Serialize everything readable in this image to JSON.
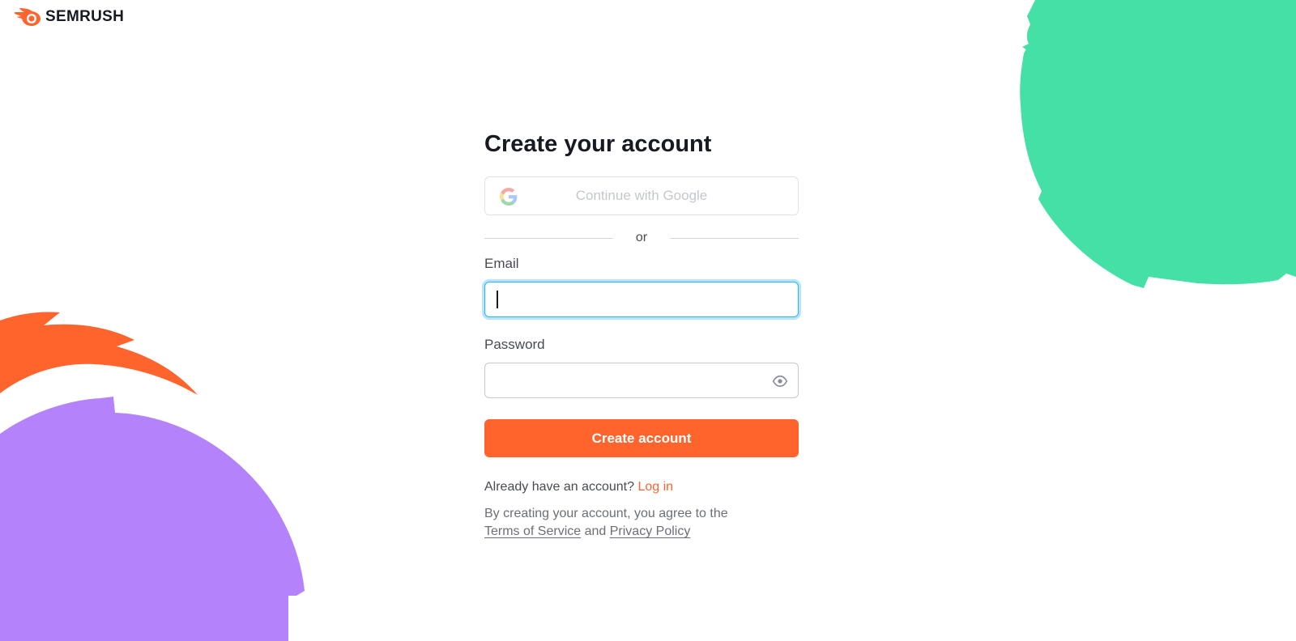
{
  "brand": {
    "name": "SEMRUSH",
    "logo_icon": "semrush-fireball-icon",
    "accent_color": "#ff642d"
  },
  "form": {
    "title": "Create your account",
    "google_button_label": "Continue with Google",
    "google_icon": "google-g-icon",
    "divider_text": "or",
    "email_label": "Email",
    "email_value": "",
    "password_label": "Password",
    "password_value": "",
    "password_toggle_icon": "eye-icon",
    "submit_label": "Create account"
  },
  "login": {
    "prompt": "Already have an account?",
    "link_label": "Log in"
  },
  "legal": {
    "text": "By creating your account, you agree to the",
    "terms_label": "Terms of Service",
    "conjunction": "and",
    "privacy_label": "Privacy Policy"
  },
  "decorations": {
    "green_shape_color": "#45e0a6",
    "purple_shape_color": "#b482fb",
    "orange_shape_color": "#ff642d"
  }
}
